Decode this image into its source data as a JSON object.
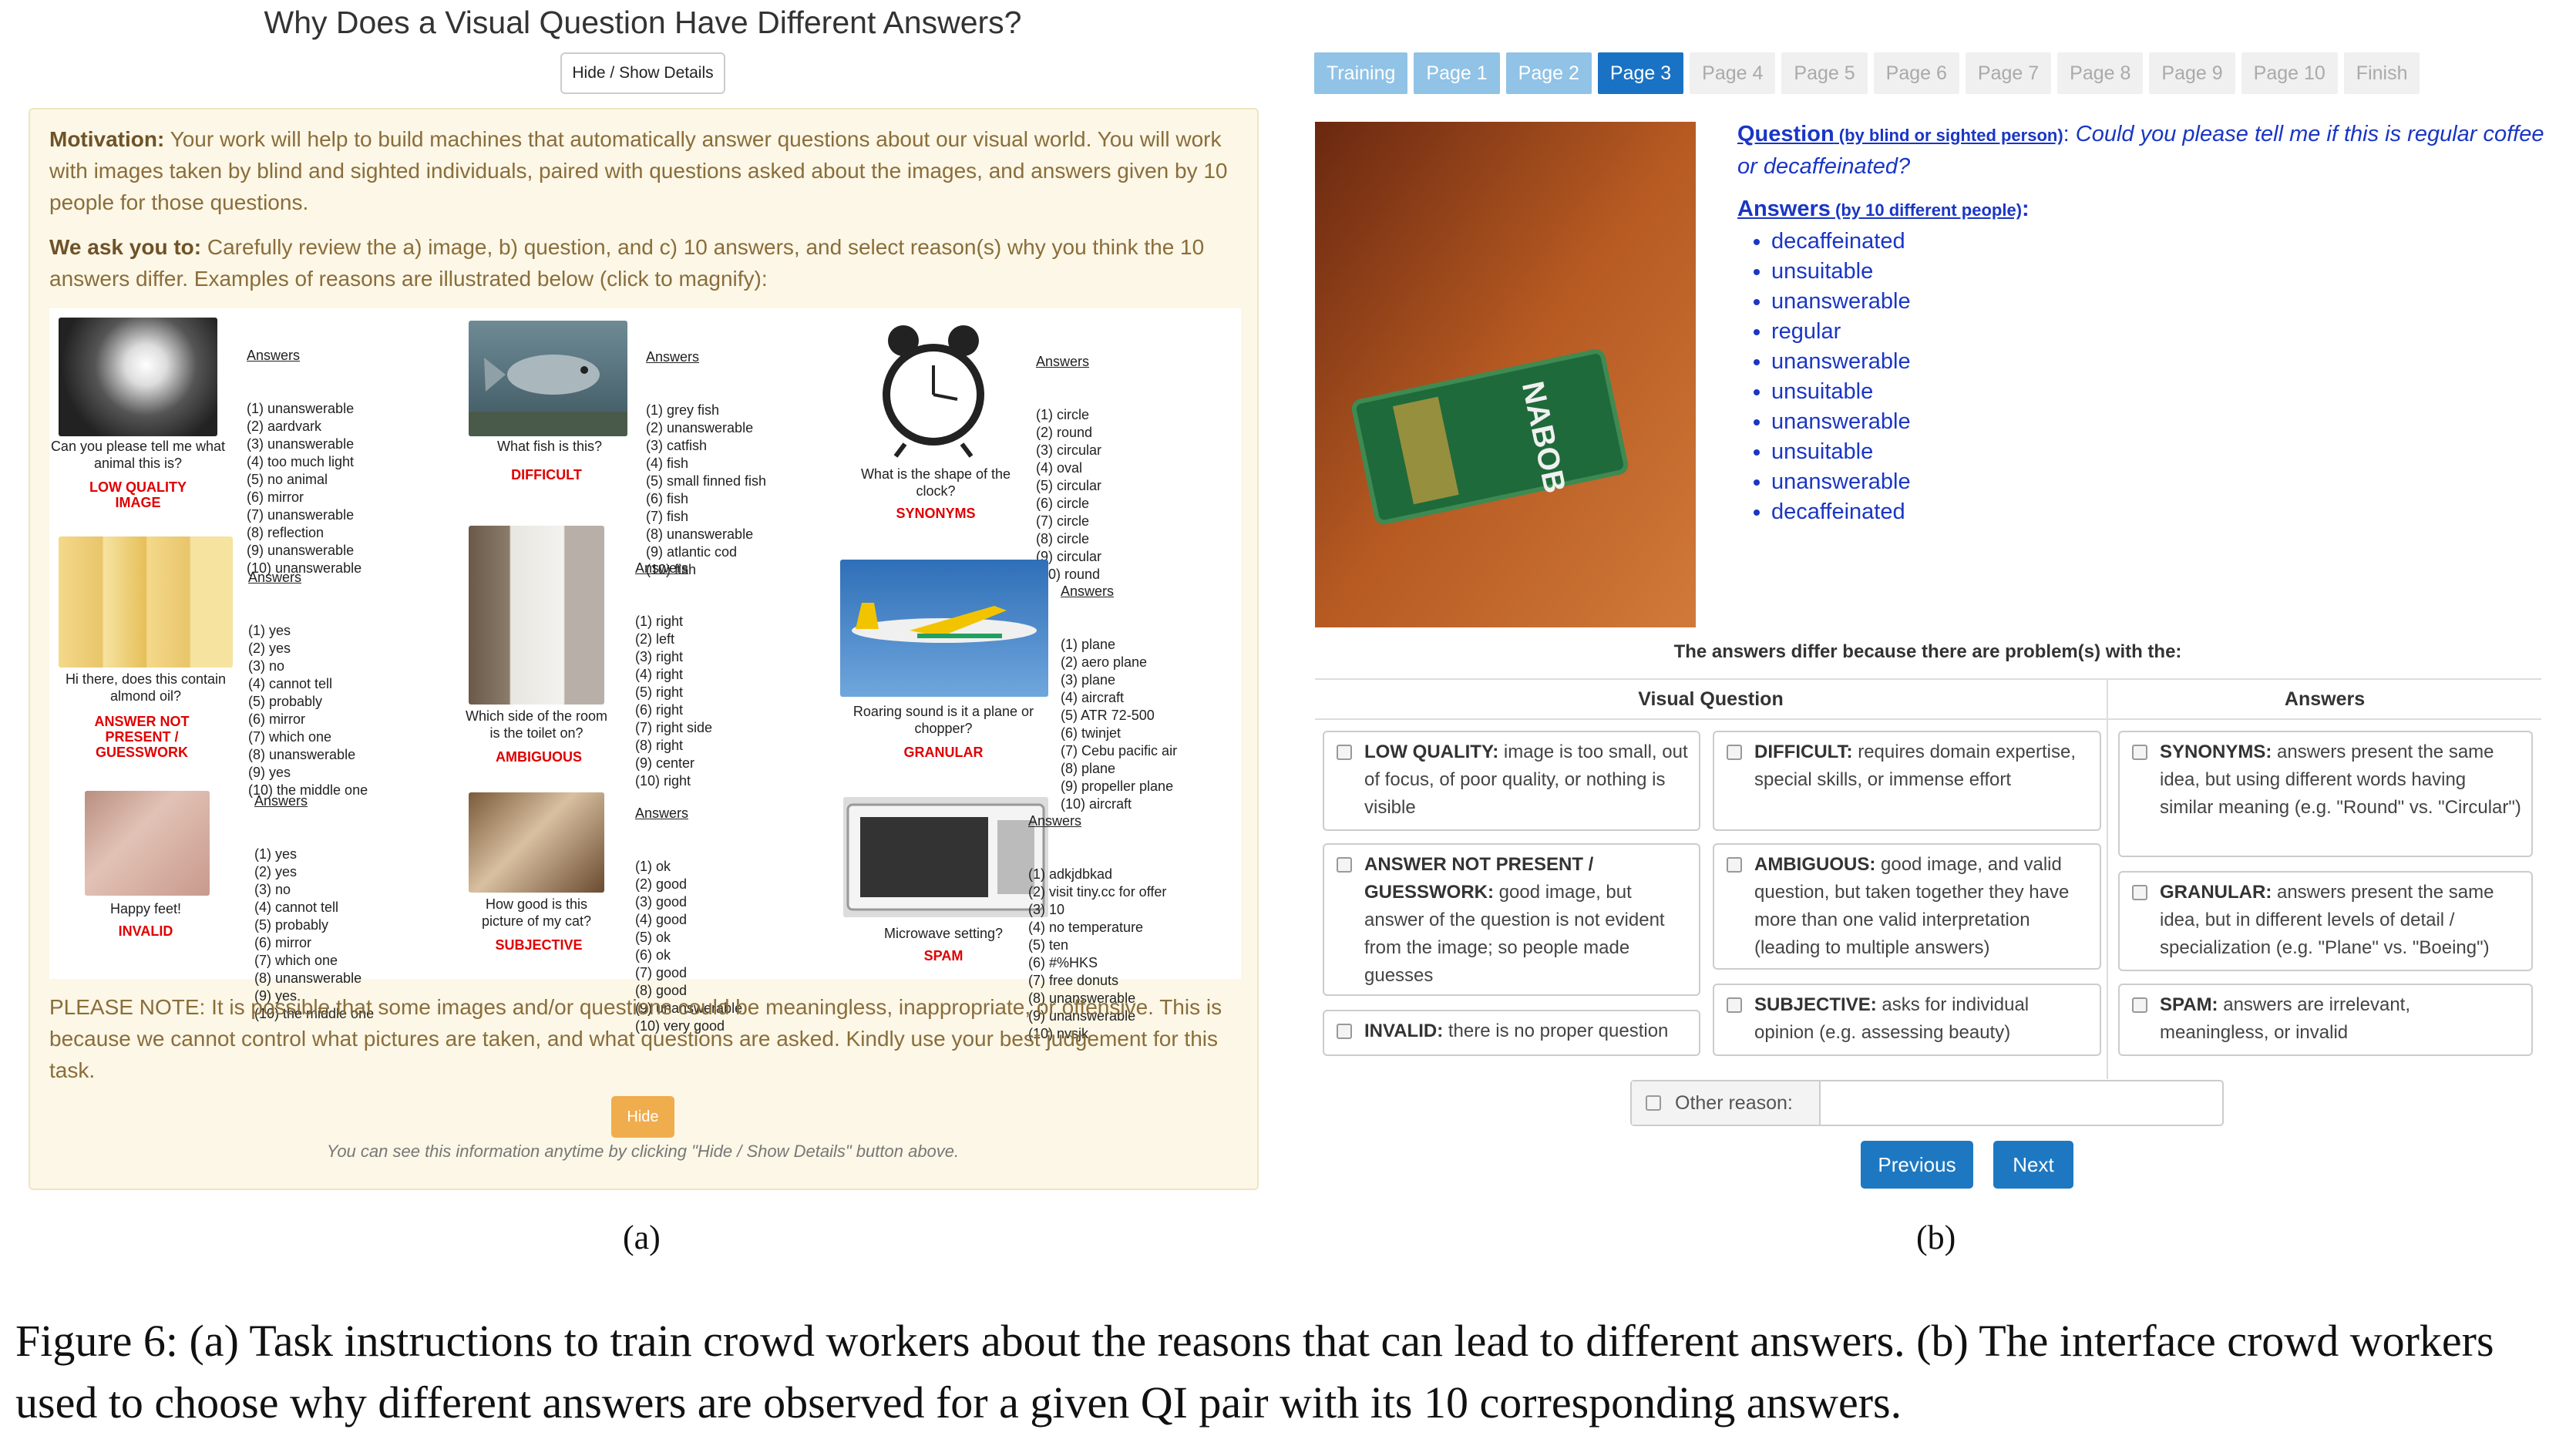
{
  "left": {
    "title": "Why Does a Visual Question Have Different Answers?",
    "hide_show_button": "Hide / Show Details",
    "motivation_label": "Motivation:",
    "motivation_text": " Your work will help to build machines that automatically answer questions about our visual world. You will work with images taken by blind and sighted individuals, paired with questions asked about the images, and answers given by 10 people for those questions.",
    "ask_label": "We ask you to:",
    "ask_text": " Carefully review the a) image, b) question, and c) 10 answers, and select reason(s) why you think the 10 answers differ. Examples of reasons are illustrated below (click to magnify):",
    "examples": [
      {
        "caption": "Can you please tell me what animal this is?",
        "reason": "LOW QUALITY IMAGE",
        "answers_header": "Answers",
        "answers": [
          "(1) unanswerable",
          "(2) aardvark",
          "(3) unanswerable",
          "(4) too much light",
          "(5) no animal",
          "(6) mirror",
          "(7) unanswerable",
          "(8) reflection",
          "(9) unanswerable",
          "(10) unanswerable"
        ]
      },
      {
        "caption": "What fish is this?",
        "reason": "DIFFICULT",
        "answers_header": "Answers",
        "answers": [
          "(1) grey fish",
          "(2) unanswerable",
          "(3) catfish",
          "(4) fish",
          "(5) small finned fish",
          "(6) fish",
          "(7) fish",
          "(8) unanswerable",
          "(9) atlantic cod",
          "(10) fish"
        ]
      },
      {
        "caption": "What is the shape of the clock?",
        "reason": "SYNONYMS",
        "answers_header": "Answers",
        "answers": [
          "(1) circle",
          "(2) round",
          "(3) circular",
          "(4) oval",
          "(5) circular",
          "(6) circle",
          "(7) circle",
          "(8) circle",
          "(9) circular",
          "(10) round"
        ]
      },
      {
        "caption": "Hi there, does this contain almond oil?",
        "reason": "ANSWER NOT PRESENT / GUESSWORK",
        "answers_header": "Answers",
        "answers": [
          "(1) yes",
          "(2) yes",
          "(3) no",
          "(4) cannot tell",
          "(5) probably",
          "(6) mirror",
          "(7) which one",
          "(8) unanswerable",
          "(9) yes",
          "(10) the middle one"
        ]
      },
      {
        "caption": "Which side of the room is the toilet on?",
        "reason": "AMBIGUOUS",
        "answers_header": "Answers",
        "answers": [
          "(1) right",
          "(2) left",
          "(3) right",
          "(4) right",
          "(5) right",
          "(6) right",
          "(7) right side",
          "(8) right",
          "(9) center",
          "(10) right"
        ]
      },
      {
        "caption": "Roaring sound is it a plane or chopper?",
        "reason": "GRANULAR",
        "answers_header": "Answers",
        "answers": [
          "(1) plane",
          "(2) aero plane",
          "(3) plane",
          "(4) aircraft",
          "(5) ATR 72-500",
          "(6) twinjet",
          "(7) Cebu pacific air",
          "(8) plane",
          "(9) propeller plane",
          "(10) aircraft"
        ]
      },
      {
        "caption": "Happy feet!",
        "reason": "INVALID",
        "answers_header": "Answers",
        "answers": [
          "(1) yes",
          "(2) yes",
          "(3) no",
          "(4) cannot tell",
          "(5) probably",
          "(6) mirror",
          "(7) which one",
          "(8) unanswerable",
          "(9) yes",
          "(10) the middle one"
        ]
      },
      {
        "caption": "How good is this picture of my cat?",
        "reason": "SUBJECTIVE",
        "answers_header": "Answers",
        "answers": [
          "(1) ok",
          "(2) good",
          "(3) good",
          "(4) good",
          "(5) ok",
          "(6) ok",
          "(7) good",
          "(8) good",
          "(9) unanswerable",
          "(10) very good"
        ]
      },
      {
        "caption": "Microwave setting?",
        "reason": "SPAM",
        "answers_header": "Answers",
        "answers": [
          "(1) adkjdbkad",
          "(2) visit tiny.cc for offer",
          "(3) 10",
          "(4) no temperature",
          "(5) ten",
          "(6) #%HKS",
          "(7) free donuts",
          "(8) unanswerable",
          "(9) unanswerable",
          "(10) nvsjk"
        ]
      }
    ],
    "note": "PLEASE NOTE: It is possible that some images and/or questions could be meaningless, inappropriate, or offensive. This is because we cannot control what pictures are taken, and what questions are asked. Kindly use your best judgement for this task.",
    "hide_button": "Hide",
    "footnote": "You can see this information anytime by clicking \"Hide / Show Details\" button above.",
    "sublabel": "(a)"
  },
  "right": {
    "tabs": [
      {
        "label": "Training",
        "state": "done"
      },
      {
        "label": "Page 1",
        "state": "done"
      },
      {
        "label": "Page 2",
        "state": "done"
      },
      {
        "label": "Page 3",
        "state": "active"
      },
      {
        "label": "Page 4",
        "state": "todo"
      },
      {
        "label": "Page 5",
        "state": "todo"
      },
      {
        "label": "Page 6",
        "state": "todo"
      },
      {
        "label": "Page 7",
        "state": "todo"
      },
      {
        "label": "Page 8",
        "state": "todo"
      },
      {
        "label": "Page 9",
        "state": "todo"
      },
      {
        "label": "Page 10",
        "state": "todo"
      },
      {
        "label": "Finish",
        "state": "todo"
      }
    ],
    "package_brand": "NABOB",
    "question_label": "Question",
    "question_sub": " (by blind or sighted person)",
    "question_colon": ":",
    "question_text": " Could you please tell me if this is regular coffee or decaffeinated?",
    "answers_label": "Answers",
    "answers_sub": " (by 10 different people)",
    "answers_colon": ":",
    "answers": [
      "decaffeinated",
      "unsuitable",
      "unanswerable",
      "regular",
      "unanswerable",
      "unsuitable",
      "unanswerable",
      "unsuitable",
      "unanswerable",
      "decaffeinated"
    ],
    "differ_text": "The answers differ because there are problem(s) with the:",
    "col_visual": "Visual Question",
    "col_answers": "Answers",
    "reasons": {
      "low_quality": {
        "label": "LOW QUALITY:",
        "text": " image is too small, out of focus, of poor quality, or nothing is visible"
      },
      "answer_not_present": {
        "label": "ANSWER NOT PRESENT / GUESSWORK:",
        "text": " good image, but answer of the question is not evident from the image; so people made guesses"
      },
      "invalid": {
        "label": "INVALID:",
        "text": " there is no proper question"
      },
      "difficult": {
        "label": "DIFFICULT:",
        "text": " requires domain expertise, special skills, or immense effort"
      },
      "ambiguous": {
        "label": "AMBIGUOUS:",
        "text": " good image, and valid question, but taken together they have more than one valid interpretation (leading to multiple answers)"
      },
      "subjective": {
        "label": "SUBJECTIVE:",
        "text": " asks for individual opinion (e.g. assessing beauty)"
      },
      "synonyms": {
        "label": "SYNONYMS:",
        "text": " answers present the same idea, but using different words having similar meaning (e.g. \"Round\" vs. \"Circular\")"
      },
      "granular": {
        "label": "GRANULAR:",
        "text": " answers present the same idea, but in different levels of detail / specialization (e.g. \"Plane\" vs. \"Boeing\")"
      },
      "spam": {
        "label": "SPAM:",
        "text": " answers are irrelevant, meaningless, or invalid"
      }
    },
    "other_label": "Other reason:",
    "other_value": "",
    "previous_button": "Previous",
    "next_button": "Next",
    "sublabel": "(b)"
  },
  "caption": "Figure 6: (a) Task instructions to train crowd workers about the reasons that can lead to different answers. (b) The interface crowd workers used to choose why different answers are observed for a given QI pair with its 10 corresponding answers."
}
